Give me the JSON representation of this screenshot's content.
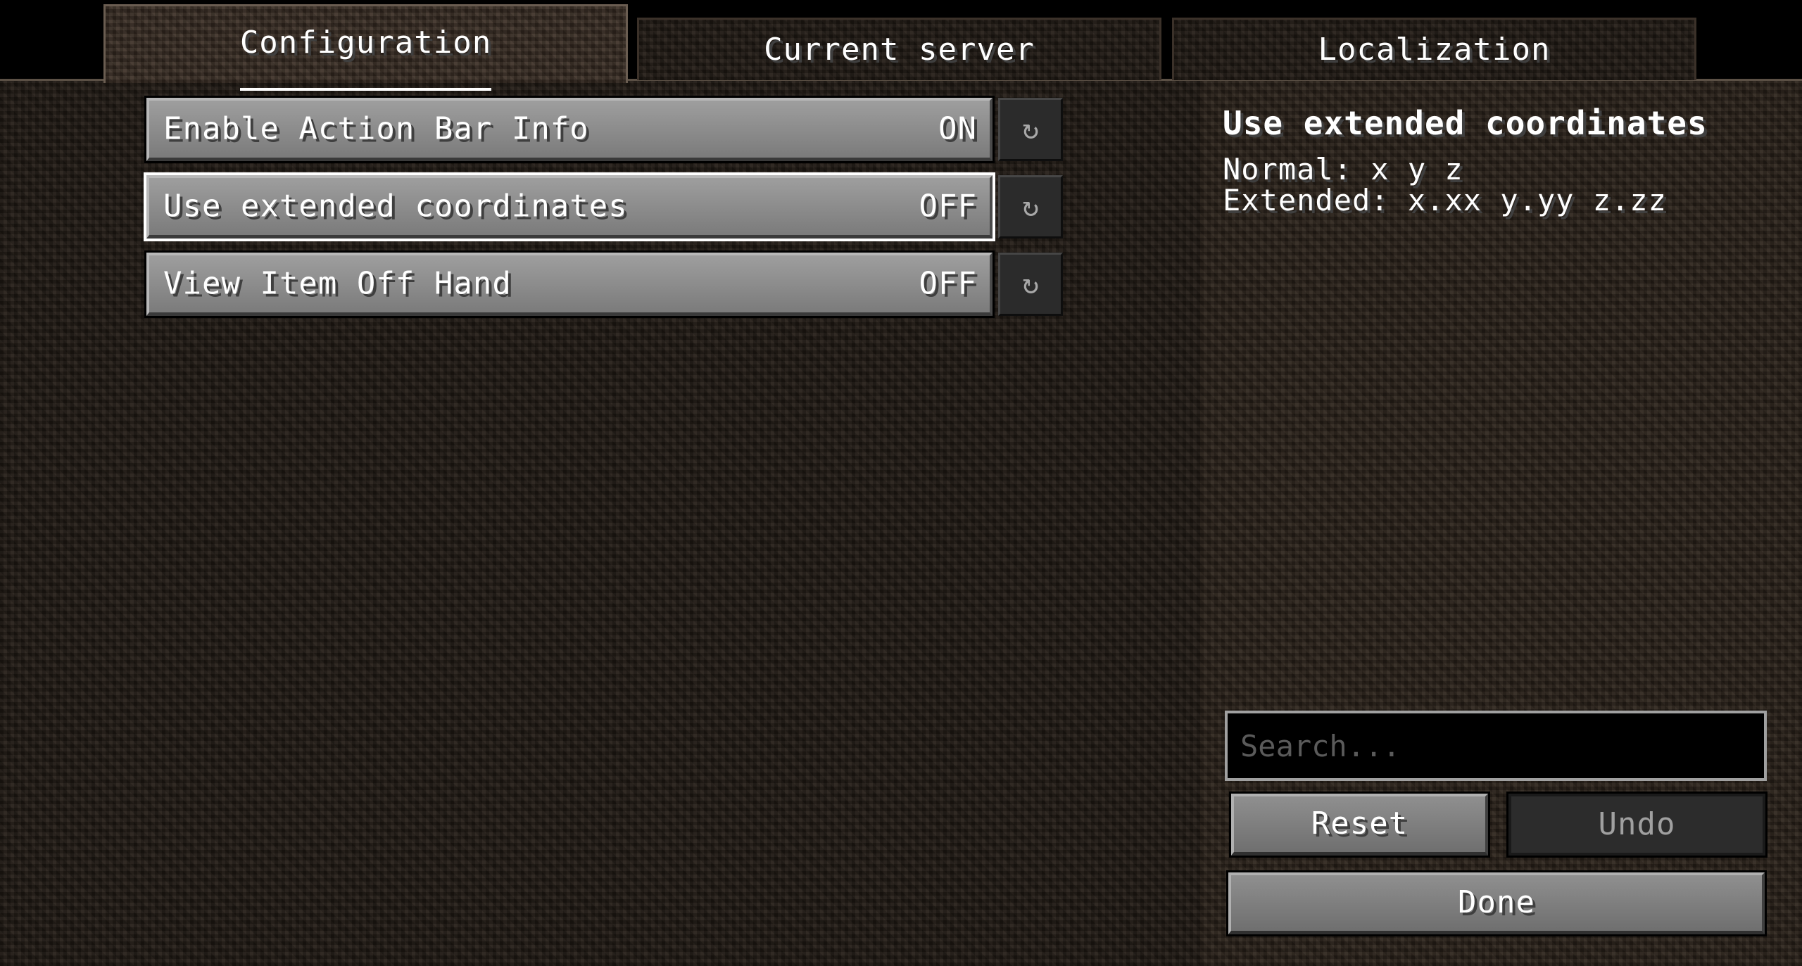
{
  "tabs": [
    {
      "label": "Configuration",
      "active": true
    },
    {
      "label": "Current server",
      "active": false
    },
    {
      "label": "Localization",
      "active": false
    }
  ],
  "options": [
    {
      "label": "Enable Action Bar Info",
      "value": "ON",
      "selected": false
    },
    {
      "label": "Use extended coordinates",
      "value": "OFF",
      "selected": true
    },
    {
      "label": "View Item Off Hand",
      "value": "OFF",
      "selected": false
    }
  ],
  "reset_icon": "↻",
  "description": {
    "title": "Use extended coordinates",
    "line1": "Normal: x y z",
    "line2": "Extended: x.xx y.yy z.zz"
  },
  "search": {
    "placeholder": "Search...",
    "value": ""
  },
  "buttons": {
    "reset": "Reset",
    "undo": "Undo",
    "done": "Done"
  },
  "colors": {
    "background": "#241d16",
    "button": "#8f8f8f",
    "button_disabled": "#2c2c2c",
    "selection_outline": "#ffffff",
    "text": "#ffffff"
  }
}
